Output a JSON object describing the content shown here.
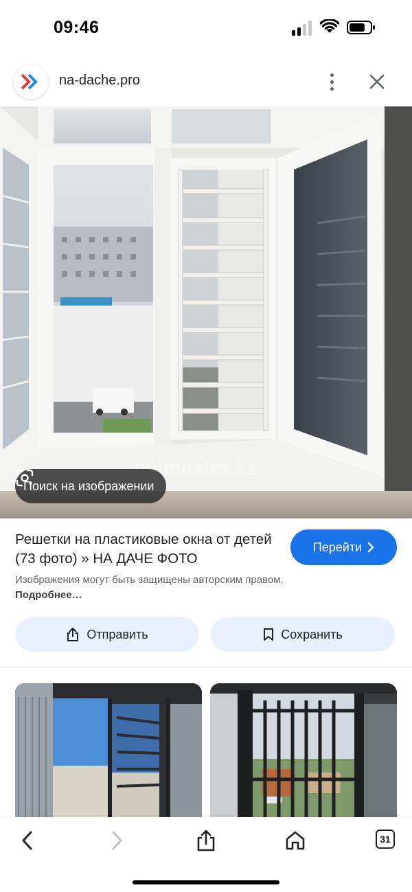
{
  "status_bar": {
    "time": "09:46"
  },
  "header": {
    "domain": "na-dache.pro",
    "logo_icon": "na-dache-chevrons-logo",
    "logo_colors": [
      "#e53935",
      "#1e88e5"
    ]
  },
  "image": {
    "watermark": "gulmaster.kz",
    "lens_label": "Поиск на изображении"
  },
  "result": {
    "title": "Решетки на пластиковые окна от детей (73 фото) » НА ДАЧЕ ФОТО",
    "visit_label": "Перейти",
    "visit_icon": "chevron-right-icon",
    "copyright_text": "Изображения могут быть защищены авторским правом.",
    "more_label": "Подробнее…"
  },
  "actions": {
    "share_label": "Отправить",
    "save_label": "Сохранить"
  },
  "bottom_bar": {
    "tabs_count": "31"
  },
  "colors": {
    "accent": "#1a73e8",
    "chip_bg": "#e8f0fe"
  }
}
